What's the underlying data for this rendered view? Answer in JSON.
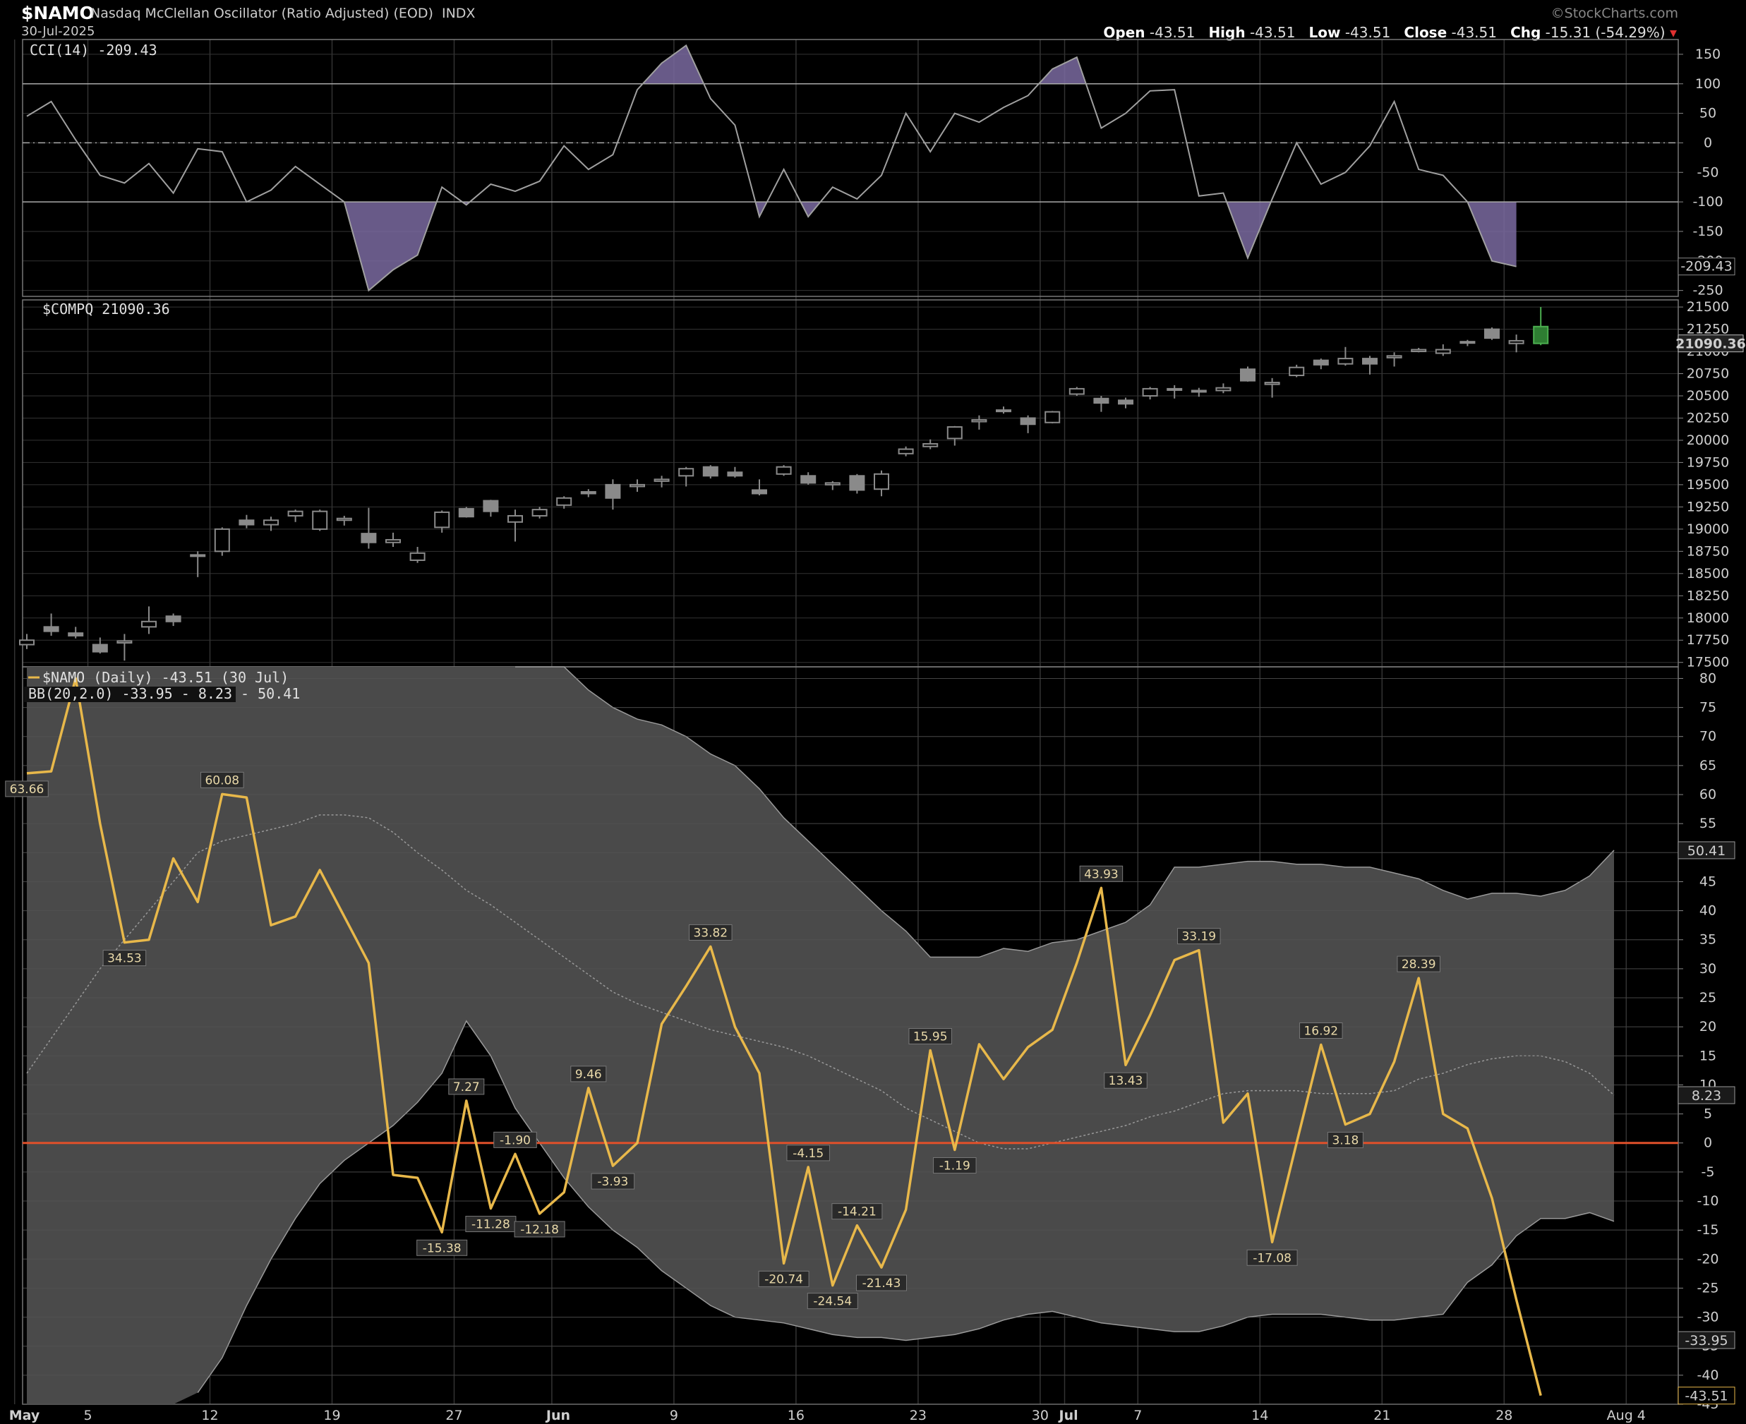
{
  "header": {
    "symbol": "$NAMO",
    "description": "Nasdaq McClellan Oscillator (Ratio Adjusted) (EOD)",
    "exchange": "INDX",
    "date": "30-Jul-2025",
    "watermark": "©StockCharts.com",
    "ohlc": {
      "open_label": "Open",
      "open": "-43.51",
      "high_label": "High",
      "high": "-43.51",
      "low_label": "Low",
      "low": "-43.51",
      "close_label": "Close",
      "close": "-43.51",
      "chg_label": "Chg",
      "chg": "-15.31 (-54.29%)"
    }
  },
  "colors": {
    "background": "#000000",
    "grid": "#333333",
    "namo_line": "#e8b84a",
    "zero_line": "#e0502a",
    "bb_fill": "#4a4a4a",
    "cci_line": "#a0a0a0",
    "cci_fill": "#7a6aa0",
    "candle": "#8a8a8a"
  },
  "chart_data": [
    {
      "type": "line",
      "panel": "top",
      "legend": "CCI(14) -209.43",
      "ylim": [
        -260,
        175
      ],
      "yticks": [
        150,
        100,
        50,
        0,
        -50,
        -100,
        -150,
        -200,
        -250
      ],
      "reference_lines": [
        100,
        0,
        -100
      ],
      "last_value_label": "-209.43",
      "series": [
        {
          "name": "CCI(14)",
          "values": [
            45,
            70,
            5,
            -55,
            -68,
            -35,
            -85,
            -10,
            -15,
            -100,
            -80,
            -40,
            -70,
            -100,
            -250,
            -215,
            -190,
            -75,
            -105,
            -70,
            -82,
            -65,
            -5,
            -45,
            -20,
            90,
            135,
            165,
            75,
            30,
            -125,
            -45,
            -125,
            -75,
            -95,
            -55,
            50,
            -15,
            50,
            35,
            60,
            80,
            125,
            145,
            25,
            50,
            88,
            90,
            -90,
            -85,
            -195,
            -95,
            0,
            -70,
            -50,
            -5,
            70,
            -45,
            -55,
            -100,
            -200,
            -209.43
          ]
        }
      ]
    },
    {
      "type": "candlestick",
      "panel": "middle",
      "legend": "$COMPQ 21090.36",
      "ylim": [
        17450,
        21580
      ],
      "yticks": [
        21500,
        21250,
        21000,
        20750,
        20500,
        20250,
        20000,
        19750,
        19500,
        19250,
        19000,
        18750,
        18500,
        18250,
        18000,
        17750,
        17500
      ],
      "last_value_label": "21090.36",
      "series": [
        {
          "name": "$COMPQ",
          "ohlc": [
            [
              17700,
              17820,
              17650,
              17750
            ],
            [
              17900,
              18050,
              17800,
              17850
            ],
            [
              17830,
              17900,
              17770,
              17800
            ],
            [
              17700,
              17780,
              17600,
              17620
            ],
            [
              17720,
              17820,
              17520,
              17740
            ],
            [
              17900,
              18130,
              17820,
              17960
            ],
            [
              18020,
              18050,
              17910,
              17960
            ],
            [
              18700,
              18750,
              18460,
              18710
            ],
            [
              18750,
              19020,
              18700,
              19000
            ],
            [
              19100,
              19160,
              19010,
              19050
            ],
            [
              19050,
              19140,
              18980,
              19100
            ],
            [
              19150,
              19220,
              19080,
              19200
            ],
            [
              19000,
              19220,
              18980,
              19200
            ],
            [
              19100,
              19150,
              19040,
              19120
            ],
            [
              18950,
              19240,
              18780,
              18850
            ],
            [
              18850,
              18960,
              18800,
              18880
            ],
            [
              18650,
              18800,
              18620,
              18730
            ],
            [
              19020,
              19210,
              18960,
              19190
            ],
            [
              19230,
              19250,
              19130,
              19140
            ],
            [
              19320,
              19330,
              19140,
              19200
            ],
            [
              19080,
              19220,
              18860,
              19150
            ],
            [
              19150,
              19250,
              19120,
              19220
            ],
            [
              19270,
              19370,
              19230,
              19350
            ],
            [
              19420,
              19450,
              19360,
              19400
            ],
            [
              19500,
              19560,
              19220,
              19350
            ],
            [
              19480,
              19560,
              19420,
              19500
            ],
            [
              19540,
              19600,
              19470,
              19560
            ],
            [
              19600,
              19700,
              19480,
              19680
            ],
            [
              19700,
              19720,
              19570,
              19600
            ],
            [
              19640,
              19700,
              19580,
              19600
            ],
            [
              19440,
              19560,
              19380,
              19400
            ],
            [
              19620,
              19720,
              19600,
              19700
            ],
            [
              19600,
              19640,
              19500,
              19520
            ],
            [
              19500,
              19540,
              19440,
              19520
            ],
            [
              19600,
              19620,
              19400,
              19440
            ],
            [
              19450,
              19660,
              19370,
              19620
            ],
            [
              19850,
              19930,
              19820,
              19900
            ],
            [
              19930,
              20010,
              19900,
              19960
            ],
            [
              20020,
              20160,
              19940,
              20150
            ],
            [
              20210,
              20280,
              20120,
              20230
            ],
            [
              20330,
              20380,
              20300,
              20340
            ],
            [
              20250,
              20280,
              20080,
              20180
            ],
            [
              20200,
              20330,
              20190,
              20320
            ],
            [
              20520,
              20600,
              20500,
              20580
            ],
            [
              20470,
              20500,
              20320,
              20420
            ],
            [
              20450,
              20480,
              20360,
              20410
            ],
            [
              20500,
              20600,
              20460,
              20580
            ],
            [
              20580,
              20620,
              20470,
              20580
            ],
            [
              20560,
              20590,
              20490,
              20550
            ],
            [
              20560,
              20640,
              20530,
              20590
            ],
            [
              20800,
              20830,
              20660,
              20670
            ],
            [
              20630,
              20700,
              20480,
              20650
            ],
            [
              20730,
              20850,
              20710,
              20820
            ],
            [
              20900,
              20920,
              20800,
              20850
            ],
            [
              20860,
              21050,
              20840,
              20920
            ],
            [
              20920,
              20950,
              20740,
              20860
            ],
            [
              20930,
              20990,
              20830,
              20950
            ],
            [
              21000,
              21040,
              20990,
              21020
            ],
            [
              20980,
              21080,
              20950,
              21020
            ],
            [
              21110,
              21130,
              21060,
              21100
            ],
            [
              21250,
              21270,
              21130,
              21150
            ],
            [
              21090,
              21190,
              20990,
              21120
            ],
            [
              21280,
              21500,
              21070,
              21090.36
            ]
          ]
        }
      ]
    },
    {
      "type": "line",
      "panel": "bottom",
      "legend": "$NAMO (Daily) -43.51 (30 Jul)",
      "legend2": "BB(20,2.0) -33.95 - 8.23 - 50.41",
      "ylim": [
        -45,
        82
      ],
      "yticks": [
        80,
        75,
        70,
        65,
        60,
        55,
        50,
        45,
        40,
        35,
        30,
        25,
        20,
        15,
        10,
        5,
        0,
        -5,
        -10,
        -15,
        -20,
        -25,
        -30,
        -35,
        -40,
        -45
      ],
      "reference_lines": [
        0
      ],
      "value_labels": [
        "50.41",
        "8.23",
        "-33.95",
        "-43.51"
      ],
      "series": [
        {
          "name": "$NAMO",
          "values": [
            63.66,
            64,
            80,
            55,
            34.53,
            35,
            49,
            41.5,
            60.08,
            59.5,
            37.5,
            39,
            47,
            39,
            31,
            -5.5,
            -6,
            -15.38,
            7.27,
            -11.28,
            -1.9,
            -12.18,
            -8.5,
            9.46,
            -3.93,
            0,
            20.5,
            27,
            33.82,
            20,
            12,
            -20.74,
            -4.15,
            -24.54,
            -14.21,
            -21.43,
            -11.5,
            15.95,
            -1.19,
            17,
            11,
            16.5,
            19.5,
            31,
            43.93,
            13.43,
            22,
            31.5,
            33.19,
            3.5,
            8.5,
            -17.08,
            0,
            16.92,
            3.18,
            5,
            14,
            28.39,
            5,
            2.5,
            -9.5,
            -27,
            -43.51
          ]
        },
        {
          "name": "BB Upper",
          "values": [
            null,
            null,
            null,
            null,
            null,
            null,
            null,
            null,
            null,
            null,
            null,
            null,
            null,
            null,
            null,
            null,
            null,
            null,
            null,
            null,
            82,
            82,
            82,
            78,
            75,
            73,
            72,
            70,
            67,
            65,
            61,
            56,
            52,
            48,
            44,
            40,
            36.5,
            32,
            32,
            32,
            33.5,
            33,
            34.5,
            35,
            36.5,
            38,
            41,
            47.5,
            47.5,
            48,
            48.5,
            48.5,
            48,
            48,
            47.5,
            47.5,
            46.5,
            45.5,
            43.5,
            42,
            43,
            43,
            42.5,
            43.5,
            46,
            50.41
          ]
        },
        {
          "name": "BB Middle",
          "values": [
            12,
            18,
            24,
            30,
            35,
            40,
            45,
            50,
            52,
            53,
            54,
            55,
            56.5,
            56.5,
            56,
            53.5,
            50,
            47,
            43.5,
            41,
            38,
            35,
            32,
            29,
            26,
            24,
            22.5,
            21,
            19.5,
            18.5,
            17.5,
            16.5,
            15,
            13,
            11,
            9,
            6,
            4,
            2,
            0,
            -1,
            -1,
            0,
            1,
            2,
            3,
            4.5,
            5.5,
            7,
            8.5,
            9,
            9,
            9,
            8.5,
            8.5,
            8.5,
            9,
            11,
            12,
            13.5,
            14.5,
            15,
            15,
            14,
            12,
            8.23
          ]
        },
        {
          "name": "BB Lower",
          "values": [
            null,
            null,
            null,
            null,
            null,
            null,
            null,
            -43,
            -37,
            -28,
            -20,
            -13,
            -7,
            -3,
            0,
            3,
            7,
            12,
            21,
            15,
            6,
            0,
            -6,
            -11,
            -15,
            -18,
            -22,
            -25,
            -28,
            -30,
            -30.5,
            -31,
            -32,
            -33,
            -33.5,
            -33.5,
            -34,
            -33.5,
            -33,
            -32,
            -30.5,
            -29.5,
            -29,
            -30,
            -31,
            -31.5,
            -32,
            -32.5,
            -32.5,
            -31.5,
            -30,
            -29.5,
            -29.5,
            -29.5,
            -30,
            -30.5,
            -30.5,
            -30,
            -29.5,
            -24,
            -21,
            -16,
            -13,
            -13,
            -12,
            -13.5,
            -16,
            -22,
            -33.95
          ]
        }
      ],
      "data_labels": [
        {
          "i": 0,
          "text": "63.66"
        },
        {
          "i": 4,
          "text": "34.53"
        },
        {
          "i": 8,
          "text": "60.08"
        },
        {
          "i": 17,
          "text": "-15.38"
        },
        {
          "i": 18,
          "text": "7.27"
        },
        {
          "i": 19,
          "text": "-11.28"
        },
        {
          "i": 20,
          "text": "-1.90"
        },
        {
          "i": 21,
          "text": "-12.18"
        },
        {
          "i": 23,
          "text": "9.46"
        },
        {
          "i": 24,
          "text": "-3.93"
        },
        {
          "i": 28,
          "text": "33.82"
        },
        {
          "i": 31,
          "text": "-20.74"
        },
        {
          "i": 32,
          "text": "-4.15"
        },
        {
          "i": 33,
          "text": "-24.54"
        },
        {
          "i": 34,
          "text": "-14.21"
        },
        {
          "i": 35,
          "text": "-21.43"
        },
        {
          "i": 37,
          "text": "15.95"
        },
        {
          "i": 38,
          "text": "-1.19"
        },
        {
          "i": 44,
          "text": "43.93"
        },
        {
          "i": 45,
          "text": "13.43"
        },
        {
          "i": 48,
          "text": "33.19"
        },
        {
          "i": 51,
          "text": "-17.08"
        },
        {
          "i": 53,
          "text": "16.92"
        },
        {
          "i": 54,
          "text": "3.18"
        },
        {
          "i": 57,
          "text": "28.39"
        }
      ]
    }
  ],
  "x_axis": {
    "labels": [
      {
        "text": "May",
        "i": -0.5,
        "bold": true
      },
      {
        "text": "5",
        "i": 2.5
      },
      {
        "text": "12",
        "i": 7.5
      },
      {
        "text": "19",
        "i": 12.5
      },
      {
        "text": "27",
        "i": 17.5
      },
      {
        "text": "Jun",
        "i": 21.5,
        "bold": true
      },
      {
        "text": "9",
        "i": 26.5
      },
      {
        "text": "16",
        "i": 31.5
      },
      {
        "text": "23",
        "i": 36.5
      },
      {
        "text": "30",
        "i": 41.5
      },
      {
        "text": "Jul",
        "i": 42.5,
        "bold": true
      },
      {
        "text": "7",
        "i": 45.5
      },
      {
        "text": "14",
        "i": 50.5
      },
      {
        "text": "21",
        "i": 55.5
      },
      {
        "text": "28",
        "i": 60.5
      },
      {
        "text": "Aug 4",
        "i": 65.5
      }
    ]
  }
}
